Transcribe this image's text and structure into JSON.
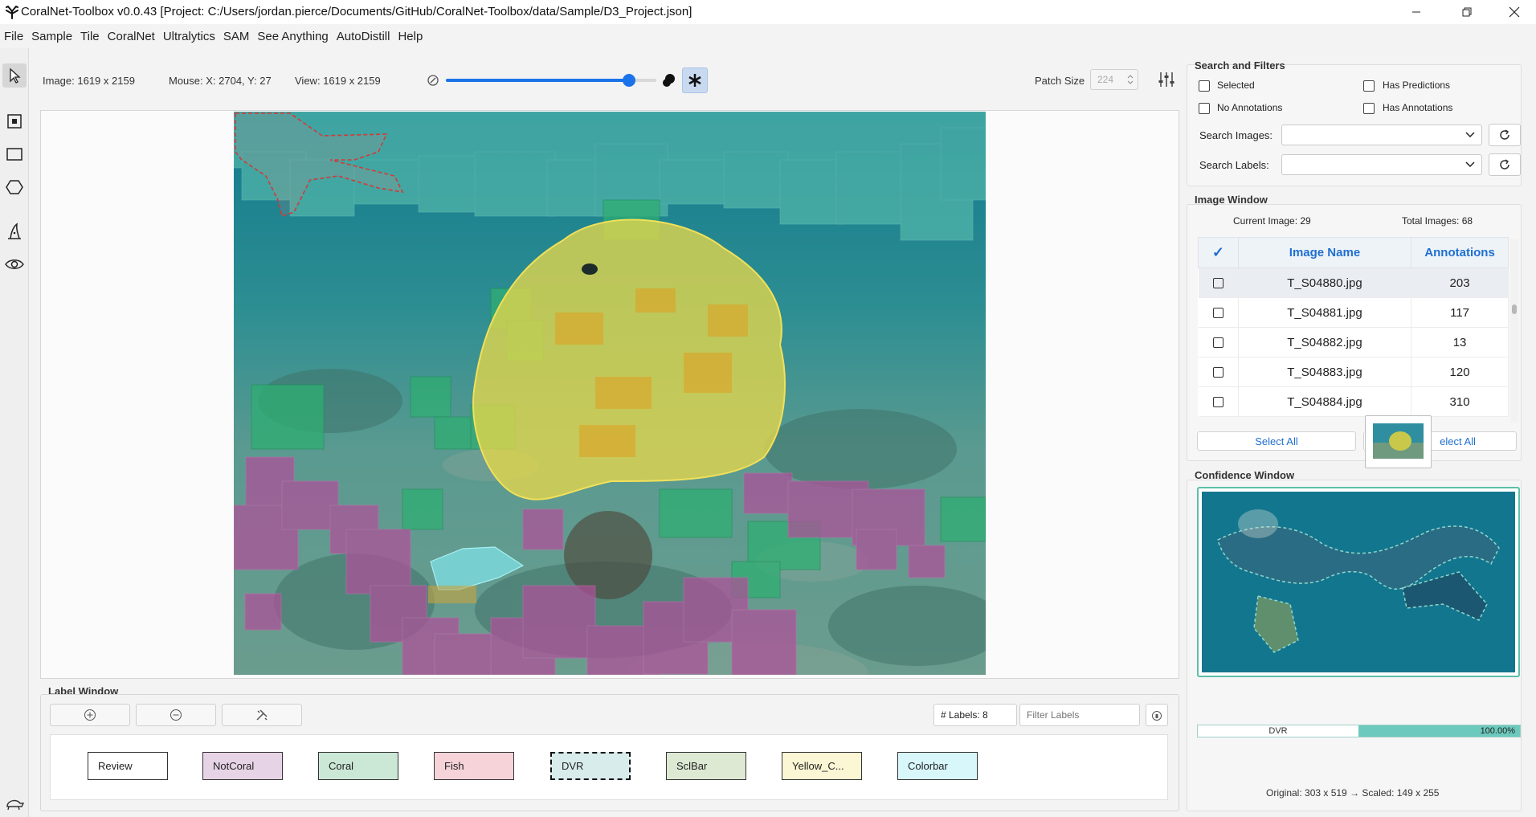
{
  "window": {
    "title": "CoralNet-Toolbox v0.0.43 [Project: C:/Users/jordan.pierce/Documents/GitHub/CoralNet-Toolbox/data/Sample/D3_Project.json]",
    "controls": [
      "minimize-icon",
      "maximize-icon",
      "close-icon"
    ]
  },
  "menu": [
    "File",
    "Sample",
    "Tile",
    "CoralNet",
    "Ultralytics",
    "SAM",
    "See Anything",
    "AutoDistill",
    "Help"
  ],
  "tools": [
    {
      "name": "select-tool",
      "icon": "cursor-arrow-icon",
      "active": true
    },
    {
      "name": "patch-tool",
      "icon": "patch-square-icon"
    },
    {
      "name": "rectangle-tool",
      "icon": "rectangle-icon"
    },
    {
      "name": "polygon-tool",
      "icon": "hexagon-icon"
    },
    {
      "name": "sam-tool",
      "icon": "wizard-hat-icon"
    },
    {
      "name": "see-anything-tool",
      "icon": "eye-icon"
    },
    {
      "name": "turtle-tool",
      "icon": "turtle-icon"
    }
  ],
  "status": {
    "image": "Image: 1619 x 2159",
    "mouse": "Mouse: X: 2704, Y: 27",
    "view": "View: 1619 x 2159",
    "transparency_percent": 87,
    "patch_size_label": "Patch Size",
    "patch_size_value": "224"
  },
  "search": {
    "title": "Search and Filters",
    "selected": "Selected",
    "has_predictions": "Has Predictions",
    "no_annotations": "No Annotations",
    "has_annotations": "Has Annotations",
    "search_images_label": "Search Images:",
    "search_labels_label": "Search Labels:"
  },
  "image_window": {
    "title": "Image Window",
    "current": "Current Image: 29",
    "total": "Total Images: 68",
    "header_check": "✓",
    "columns": [
      "Image Name",
      "Annotations"
    ],
    "rows": [
      {
        "name": "T_S04880.jpg",
        "count": "203"
      },
      {
        "name": "T_S04881.jpg",
        "count": "117"
      },
      {
        "name": "T_S04882.jpg",
        "count": "13"
      },
      {
        "name": "T_S04883.jpg",
        "count": "120"
      },
      {
        "name": "T_S04884.jpg",
        "count": "310"
      }
    ],
    "select_all": "Select All",
    "deselect_all": "elect All"
  },
  "confidence": {
    "title": "Confidence Window",
    "label": "DVR",
    "value": "100.00%",
    "value_fraction": 1.0,
    "dims": "Original: 303 x 519 → Scaled: 149 x 255"
  },
  "label_window": {
    "title": "Label Window",
    "count": "# Labels: 8",
    "filter_placeholder": "Filter Labels",
    "labels": [
      {
        "name": "Review",
        "color": "#ffffff"
      },
      {
        "name": "NotCoral",
        "color": "#e7d3e6"
      },
      {
        "name": "Coral",
        "color": "#cbe7d6"
      },
      {
        "name": "Fish",
        "color": "#f5d3d9"
      },
      {
        "name": "DVR",
        "color": "#d9ecec",
        "selected": true
      },
      {
        "name": "SclBar",
        "color": "#dde9d3"
      },
      {
        "name": "Yellow_C...",
        "color": "#fbf6d3"
      },
      {
        "name": "Colorbar",
        "color": "#d8f7fb"
      }
    ]
  },
  "colors": {
    "accent": "#1f6fd1",
    "confidence_bar": "#6cc9bd",
    "slider": "#1a73e8"
  }
}
